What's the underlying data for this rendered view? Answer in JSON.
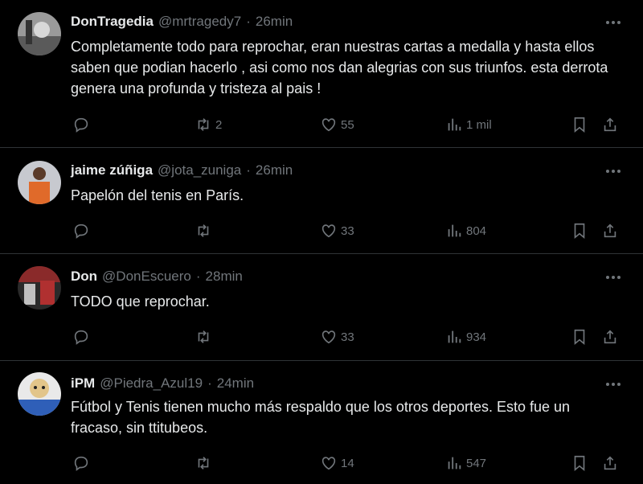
{
  "tweets": [
    {
      "name": "DonTragedia",
      "handle": "@mrtragedy7",
      "time": "26min",
      "text": "Completamente todo para reprochar, eran nuestras cartas a medalla y hasta ellos saben que podian hacerlo , asi como nos dan alegrias con sus triunfos. esta derrota genera una profunda y tristeza al pais !",
      "replies": "",
      "retweets": "2",
      "likes": "55",
      "views": "1 mil"
    },
    {
      "name": "jaime zúñiga",
      "handle": "@jota_zuniga",
      "time": "26min",
      "text": "Papelón del tenis en París.",
      "replies": "",
      "retweets": "",
      "likes": "33",
      "views": "804"
    },
    {
      "name": "Don",
      "handle": "@DonEscuero",
      "time": "28min",
      "text": "TODO que reprochar.",
      "replies": "",
      "retweets": "",
      "likes": "33",
      "views": "934"
    },
    {
      "name": "iPM",
      "handle": "@Piedra_Azul19",
      "time": "24min",
      "text": "Fútbol y Tenis tienen mucho más respaldo que los otros deportes. Esto fue un fracaso, sin ttitubeos.",
      "replies": "",
      "retweets": "",
      "likes": "14",
      "views": "547"
    }
  ],
  "separator": "·",
  "colors": {
    "background": "#000000",
    "text": "#e7e9ea",
    "muted": "#71767b",
    "border": "#2f3336"
  }
}
